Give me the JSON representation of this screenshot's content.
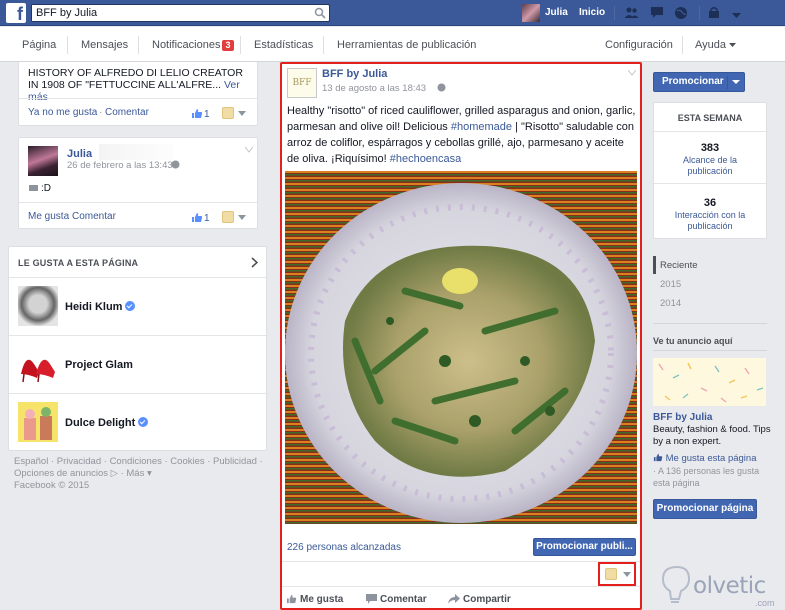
{
  "topbar": {
    "search_value": "BFF by Julia",
    "user_name": "Julia",
    "home_label": "Inicio"
  },
  "pagenav": {
    "items": [
      "Página",
      "Mensajes",
      "Notificaciones",
      "Estadísticas",
      "Herramientas de publicación"
    ],
    "notifications_badge": "3",
    "settings_label": "Configuración",
    "help_label": "Ayuda"
  },
  "left_posts": [
    {
      "text": "HISTORY OF ALFREDO DI LELIO CREATOR IN 1908 OF \"FETTUCCINE ALL'ALFRE...",
      "see_more": "Ver más",
      "action_like": "Ya no me gusta",
      "action_comment": "Comentar",
      "like_count": "1"
    },
    {
      "author": "Julia",
      "time": "26 de febrero a las 13:43",
      "body": ":D",
      "action_like": "Me gusta",
      "action_comment": "Comentar",
      "like_count": "1"
    }
  ],
  "liked_pages": {
    "title": "LE GUSTA A ESTA PÁGINA",
    "items": [
      {
        "name": "Heidi Klum",
        "verified": true
      },
      {
        "name": "Project Glam",
        "verified": false
      },
      {
        "name": "Dulce Delight",
        "verified": true
      }
    ]
  },
  "footer": {
    "line1": "Español · Privacidad · Condiciones · Cookies · Publicidad ·",
    "line2": "Opciones de anuncios ▷ · Más ▾",
    "line3": "Facebook © 2015"
  },
  "post": {
    "logo_text": "BFF",
    "author": "BFF by Julia",
    "time": "13 de agosto a las 18:43",
    "text_1": "Healthy \"risotto\" of riced cauliflower, grilled asparagus and onion, garlic, parmesan and olive oil! Delicious ",
    "hashtag_1": "#homemade",
    "text_2": " | \"Risotto\" saludable con arroz de coliflor, espárragos y cebollas grillé, ajo, parmesano y aceite de oliva. ¡Riquísimo! ",
    "hashtag_2": "#hechoencasa",
    "reach": "226 personas alcanzadas",
    "promote_button": "Promocionar publi...",
    "actions": {
      "like": "Me gusta",
      "comment": "Comentar",
      "share": "Compartir"
    }
  },
  "right": {
    "promote_button": "Promocionar",
    "week_title": "ESTA SEMANA",
    "stats": [
      {
        "value": "383",
        "label": "Alcance de la publicación"
      },
      {
        "value": "36",
        "label": "Interacción con la publicación"
      }
    ],
    "timeline": [
      "Reciente",
      "2015",
      "2014"
    ],
    "ad_heading": "Ve tu anuncio aquí",
    "ad_name": "BFF by Julia",
    "ad_desc": "Beauty, fashion & food. Tips by a non expert.",
    "ad_like": "Me gusta esta página",
    "ad_count": "· A 136 personas les gusta esta página",
    "promote_page_button": "Promocionar página"
  },
  "watermark": {
    "text": "olvetic",
    "suffix": ".com"
  },
  "colors": {
    "brand": "#3b5998",
    "highlight": "#e3201b",
    "button": "#4267b2"
  }
}
